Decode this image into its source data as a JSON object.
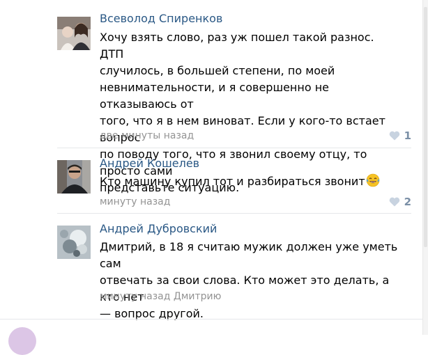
{
  "comments": [
    {
      "author": "Всеволод Спиренков",
      "lines": [
        "Хочу взять слово, раз уж пошел такой разнос. ДТП",
        "случилось, в большей степени, по моей",
        "невнимательности, и я совершенно не отказываюсь от",
        "того, что я в нем виноват. Если у кого-то встает вопрос",
        "по поводу того, что я звонил своему отцу, то просто сами",
        "представьте ситуацию."
      ],
      "time": "две минуты назад",
      "likes": "1",
      "avatar_icon": "avatar-photo-couple"
    },
    {
      "author": "Андрей Кошелев",
      "text": "Кто машину купил тот и разбираться звонит",
      "emoji": "tears-of-joy-emoji",
      "time": "минуту назад",
      "likes": "2",
      "avatar_icon": "avatar-photo-man"
    },
    {
      "author": "Андрей Дубровский",
      "lines": [
        "Дмитрий, в 18 я считаю мужик должен уже уметь сам",
        "отвечать за свои слова. Кто может это делать, а кто нет",
        "— вопрос другой."
      ],
      "time": "минуту назад",
      "reply_to": "Дмитрию",
      "avatar_icon": "avatar-photo-blurred"
    }
  ],
  "colors": {
    "author_link": "#2a5885",
    "meta": "#939393",
    "like": "#7a8fa6"
  }
}
